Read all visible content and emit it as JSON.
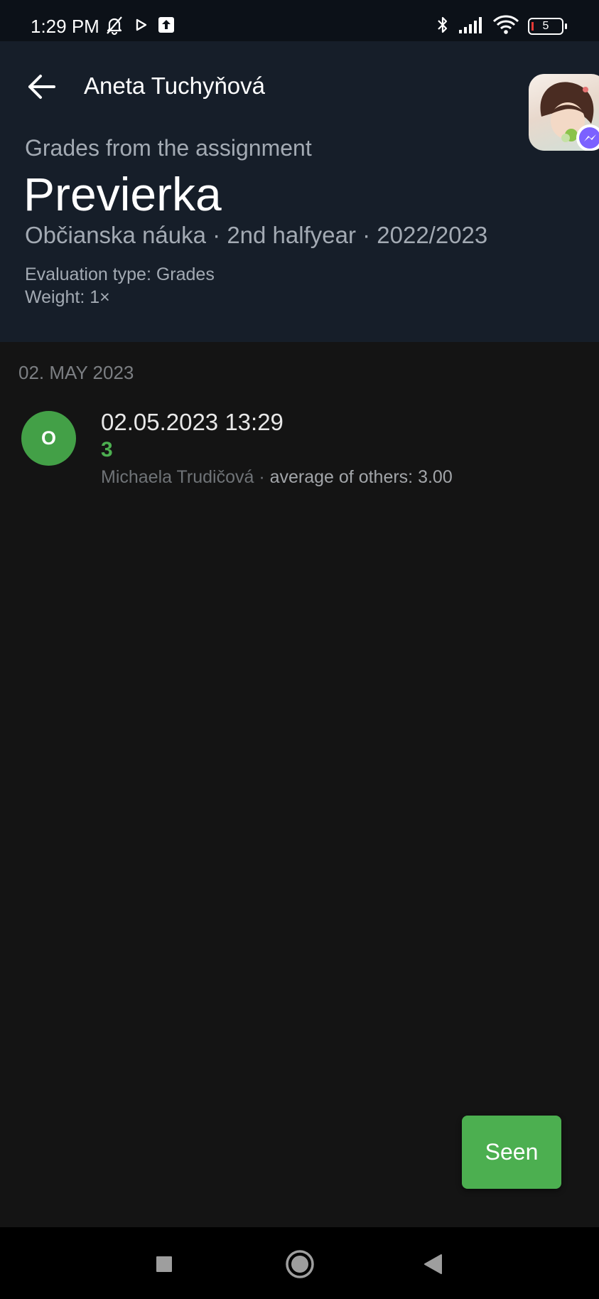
{
  "status_bar": {
    "time": "1:29 PM",
    "battery_level": "5",
    "icons": [
      "bell-off-icon",
      "play-icon",
      "upload-icon",
      "bluetooth-icon",
      "signal-icon",
      "wifi-icon",
      "battery-icon"
    ]
  },
  "header": {
    "student_name": "Aneta Tuchyňová",
    "subtitle": "Grades from the assignment",
    "title": "Previerka",
    "meta": "Občianska náuka · 2nd halfyear · 2022/2023",
    "evaluation_type": "Evaluation type: Grades",
    "weight": "Weight: 1×"
  },
  "list": {
    "date_header": "02. MAY 2023",
    "items": [
      {
        "avatar_letter": "O",
        "datetime": "02.05.2023 13:29",
        "grade": "3",
        "teacher": "Michaela Trudičová",
        "separator": " · ",
        "average": "average of others: 3.00"
      }
    ]
  },
  "actions": {
    "seen_label": "Seen"
  },
  "colors": {
    "header_bg": "#161e29",
    "body_bg": "#141414",
    "accent_green": "#4caf50"
  }
}
